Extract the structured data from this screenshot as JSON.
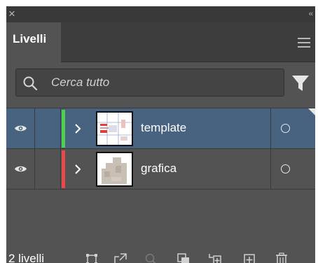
{
  "panel": {
    "tab_label": "Livelli",
    "collapse_glyph": "‹‹",
    "close_glyph": "×"
  },
  "search": {
    "placeholder": "Cerca tutto",
    "value": ""
  },
  "layers": [
    {
      "name": "template",
      "visible": true,
      "color": "#4fd04f",
      "selected": true,
      "target": "circle"
    },
    {
      "name": "grafica",
      "visible": true,
      "color": "#e84a4a",
      "selected": false,
      "target": "circle"
    }
  ],
  "footer": {
    "layer_count": "2 livelli",
    "buttons": [
      "collect-for-export-icon",
      "locate-object-icon",
      "search-layer-icon",
      "make-clipping-mask-icon",
      "create-sublayer-icon",
      "create-new-layer-icon",
      "trash-icon"
    ]
  },
  "colors": {
    "panel_bg": "#535353",
    "tabstrip_bg": "#3d3d3d",
    "titlebar_bg": "#393939",
    "selected_row": "#47637f",
    "text": "#ffffff"
  }
}
